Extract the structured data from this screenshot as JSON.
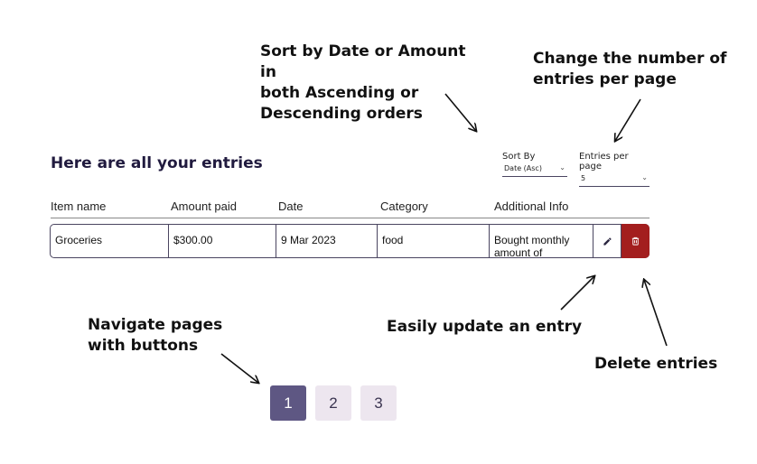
{
  "annotations": {
    "sort": "Sort by Date or Amount in\nboth Ascending or\nDescending orders",
    "entries_per_page": "Change the number of\nentries per page",
    "navigate": "Navigate pages\nwith buttons",
    "update": "Easily update an entry",
    "delete": "Delete entries"
  },
  "page_title": "Here are all your entries",
  "controls": {
    "sort_by": {
      "label": "Sort By",
      "value": "Date (Asc)",
      "icon": "chevron-down-icon"
    },
    "entries_per_page": {
      "label": "Entries per page",
      "value": "5",
      "icon": "chevron-down-icon"
    }
  },
  "table": {
    "headers": [
      "Item name",
      "Amount paid",
      "Date",
      "Category",
      "Additional Info"
    ],
    "rows": [
      {
        "item_name": "Groceries",
        "amount_paid": "$300.00",
        "date": "9 Mar 2023",
        "category": "food",
        "additional_info": "Bought monthly amount of"
      }
    ],
    "row_actions": {
      "edit_icon": "pencil-icon",
      "delete_icon": "trash-icon"
    }
  },
  "pagination": {
    "pages": [
      "1",
      "2",
      "3"
    ],
    "current": "1"
  },
  "colors": {
    "title": "#211b3f",
    "delete": "#a31e1e",
    "page_active": "#5e5783",
    "page_inactive": "#ede6ef"
  }
}
